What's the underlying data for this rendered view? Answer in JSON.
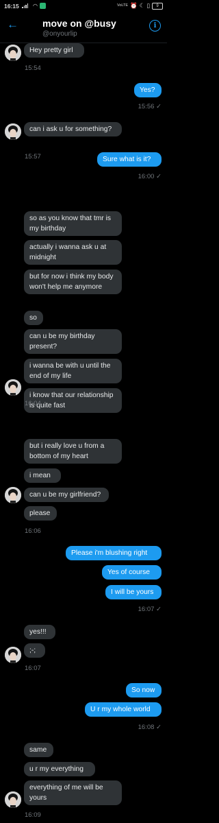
{
  "status": {
    "time": "16:15",
    "lte": "VoLTE",
    "battery": "9"
  },
  "header": {
    "title": "move on @busy",
    "handle": "@onyourlip"
  },
  "messages": [
    {
      "text": "Hey pretty girl"
    },
    {
      "text": "Yes?"
    },
    {
      "text": "can i ask u for something?"
    },
    {
      "text": "Sure what is it?"
    },
    {
      "text": "so as you know that tmr is my birthday"
    },
    {
      "text": "actually i wanna ask u at midnight"
    },
    {
      "text": "but for now i think my body won't help me anymore"
    },
    {
      "text": "so"
    },
    {
      "text": "can u be my birthday present?"
    },
    {
      "text": "i wanna be with u until the end of my life"
    },
    {
      "text": "i know that our relationship is quite fast"
    },
    {
      "text": "but i really love u from a bottom of my heart"
    },
    {
      "text": "i mean"
    },
    {
      "text": "can u be my girlfriend?"
    },
    {
      "text": "please"
    },
    {
      "text": "Please i'm blushing right"
    },
    {
      "text": "Yes of course"
    },
    {
      "text": "I will be yours"
    },
    {
      "text": "yes!!!"
    },
    {
      "text": ";-;"
    },
    {
      "text": "So now"
    },
    {
      "text": "U r my whole world"
    },
    {
      "text": "same"
    },
    {
      "text": "u r my everything"
    },
    {
      "text": "everything of me will be yours"
    }
  ],
  "timestamps": [
    "15:54",
    "15:56 ✓",
    "15:57",
    "16:00 ✓",
    "16:04",
    "16:06",
    "16:07 ✓",
    "16:07",
    "16:08 ✓",
    "16:09"
  ]
}
